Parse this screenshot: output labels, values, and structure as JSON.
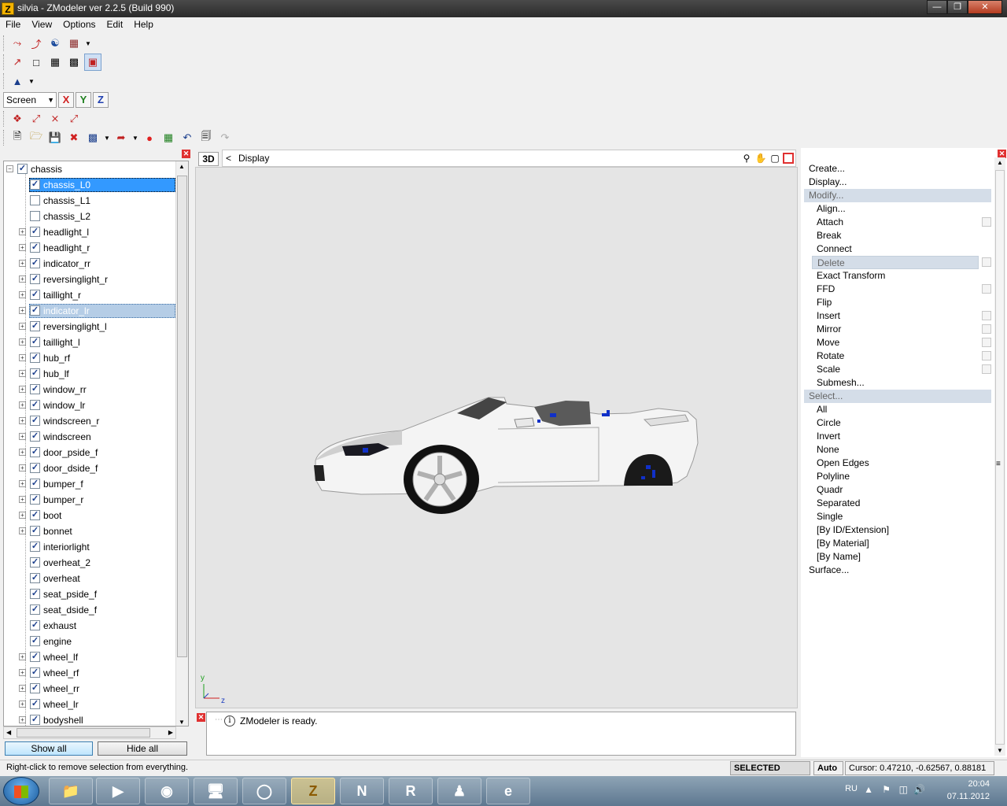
{
  "window": {
    "title": "silvia - ZModeler ver 2.2.5 (Build 990)",
    "app_icon": "Z"
  },
  "menubar": [
    "File",
    "View",
    "Options",
    "Edit",
    "Help"
  ],
  "toolbar": {
    "screen_select": "Screen",
    "axes": [
      "X",
      "Y",
      "Z"
    ]
  },
  "tree": {
    "root": "chassis",
    "items": [
      {
        "label": "chassis_L0",
        "checked": true,
        "expandable": false,
        "state": "selected-active"
      },
      {
        "label": "chassis_L1",
        "checked": false,
        "expandable": false
      },
      {
        "label": "chassis_L2",
        "checked": false,
        "expandable": false
      },
      {
        "label": "headlight_l",
        "checked": true,
        "expandable": true
      },
      {
        "label": "headlight_r",
        "checked": true,
        "expandable": true
      },
      {
        "label": "indicator_rr",
        "checked": true,
        "expandable": true
      },
      {
        "label": "reversinglight_r",
        "checked": true,
        "expandable": true
      },
      {
        "label": "taillight_r",
        "checked": true,
        "expandable": true
      },
      {
        "label": "indicator_lr",
        "checked": true,
        "expandable": true,
        "state": "selected-inactive"
      },
      {
        "label": "reversinglight_l",
        "checked": true,
        "expandable": true
      },
      {
        "label": "taillight_l",
        "checked": true,
        "expandable": true
      },
      {
        "label": "hub_rf",
        "checked": true,
        "expandable": true
      },
      {
        "label": "hub_lf",
        "checked": true,
        "expandable": true
      },
      {
        "label": "window_rr",
        "checked": true,
        "expandable": true
      },
      {
        "label": "window_lr",
        "checked": true,
        "expandable": true
      },
      {
        "label": "windscreen_r",
        "checked": true,
        "expandable": true
      },
      {
        "label": "windscreen",
        "checked": true,
        "expandable": true
      },
      {
        "label": "door_pside_f",
        "checked": true,
        "expandable": true
      },
      {
        "label": "door_dside_f",
        "checked": true,
        "expandable": true
      },
      {
        "label": "bumper_f",
        "checked": true,
        "expandable": true
      },
      {
        "label": "bumper_r",
        "checked": true,
        "expandable": true
      },
      {
        "label": "boot",
        "checked": true,
        "expandable": true
      },
      {
        "label": "bonnet",
        "checked": true,
        "expandable": true
      },
      {
        "label": "interiorlight",
        "checked": true,
        "expandable": false
      },
      {
        "label": "overheat_2",
        "checked": true,
        "expandable": false
      },
      {
        "label": "overheat",
        "checked": true,
        "expandable": false
      },
      {
        "label": "seat_pside_f",
        "checked": true,
        "expandable": false
      },
      {
        "label": "seat_dside_f",
        "checked": true,
        "expandable": false
      },
      {
        "label": "exhaust",
        "checked": true,
        "expandable": false
      },
      {
        "label": "engine",
        "checked": true,
        "expandable": false
      },
      {
        "label": "wheel_lf",
        "checked": true,
        "expandable": true
      },
      {
        "label": "wheel_rf",
        "checked": true,
        "expandable": true
      },
      {
        "label": "wheel_rr",
        "checked": true,
        "expandable": true
      },
      {
        "label": "wheel_lr",
        "checked": true,
        "expandable": true
      },
      {
        "label": "bodyshell",
        "checked": true,
        "expandable": true
      }
    ],
    "show_all": "Show all",
    "hide_all": "Hide all"
  },
  "viewport": {
    "mode_button": "3D",
    "back": "<",
    "title": "Display",
    "axis_y": "y",
    "axis_z": "z"
  },
  "output": {
    "message": "ZModeler is ready."
  },
  "right_menu": {
    "create": "Create...",
    "display": "Display...",
    "modify": "Modify...",
    "modify_items": [
      "Align...",
      "Attach",
      "Break",
      "Connect",
      "Delete",
      "Exact Transform",
      "FFD",
      "Flip",
      "Insert",
      "Mirror",
      "Move",
      "Rotate",
      "Scale",
      "Submesh..."
    ],
    "select": "Select...",
    "select_items": [
      "All",
      "Circle",
      "Invert",
      "None",
      "Open Edges",
      "Polyline",
      "Quadr",
      "Separated",
      "Single",
      "[By ID/Extension]",
      "[By Material]",
      "[By Name]"
    ],
    "surface": "Surface..."
  },
  "statusbar": {
    "hint": "Right-click to remove selection from everything.",
    "mode": "SELECTED MODE",
    "auto": "Auto",
    "cursor": "Cursor: 0.47210, -0.62567, 0.88181"
  },
  "taskbar": {
    "lang": "RU",
    "time": "20:04",
    "date": "07.11.2012",
    "apps": [
      "explorer-icon",
      "media-player-icon",
      "chrome-icon",
      "computer-icon",
      "app-icon",
      "zmodeler-icon",
      "notepad-icon",
      "rockstar-icon",
      "game-icon",
      "browser-icon"
    ]
  }
}
